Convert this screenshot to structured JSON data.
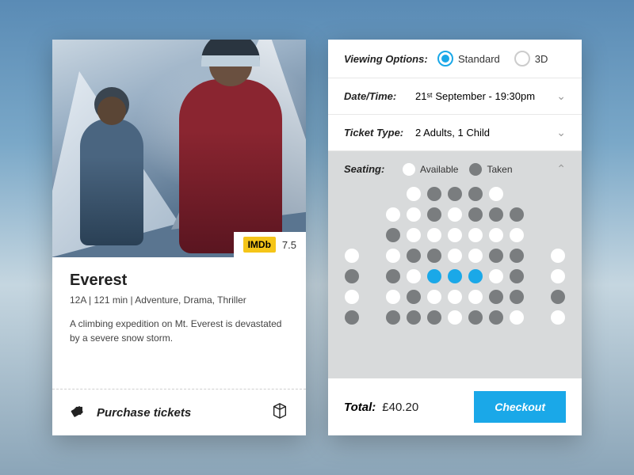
{
  "movie": {
    "title": "Everest",
    "imdb_label": "IMDb",
    "imdb_rating": "7.5",
    "meta": "12A  |  121 min  |  Adventure, Drama, Thriller",
    "description": "A climbing expedition on Mt. Everest is devastated by a severe snow storm.",
    "purchase_label": "Purchase tickets"
  },
  "booking": {
    "viewing": {
      "label": "Viewing Options:",
      "options": [
        "Standard",
        "3D"
      ],
      "selected": "Standard"
    },
    "datetime": {
      "label": "Date/Time:",
      "value": "21ˢᵗ September - 19:30pm"
    },
    "ticket_type": {
      "label": "Ticket Type:",
      "value": "2 Adults, 1 Child"
    },
    "seating": {
      "label": "Seating:",
      "legend_available": "Available",
      "legend_taken": "Taken",
      "rows": [
        [
          "gap",
          "gap",
          "gap",
          "available",
          "taken",
          "taken",
          "taken",
          "available",
          "gap",
          "gap",
          "gap"
        ],
        [
          "gap",
          "gap",
          "available",
          "available",
          "taken",
          "available",
          "taken",
          "taken",
          "taken",
          "gap",
          "gap"
        ],
        [
          "gap",
          "gap",
          "taken",
          "available",
          "available",
          "available",
          "available",
          "available",
          "available",
          "gap",
          "gap"
        ],
        [
          "available",
          "gap",
          "available",
          "taken",
          "taken",
          "available",
          "available",
          "taken",
          "taken",
          "gap",
          "available"
        ],
        [
          "taken",
          "gap",
          "taken",
          "available",
          "selected",
          "selected",
          "selected",
          "available",
          "taken",
          "gap",
          "available"
        ],
        [
          "available",
          "gap",
          "available",
          "taken",
          "available",
          "available",
          "available",
          "taken",
          "taken",
          "gap",
          "taken"
        ],
        [
          "taken",
          "gap",
          "taken",
          "taken",
          "taken",
          "available",
          "taken",
          "taken",
          "available",
          "gap",
          "available"
        ]
      ]
    },
    "total": {
      "label": "Total:",
      "value": "£40.20"
    },
    "checkout_label": "Checkout"
  },
  "colors": {
    "accent": "#1aa8e8",
    "taken": "#7a7d7f",
    "available": "#ffffff"
  }
}
